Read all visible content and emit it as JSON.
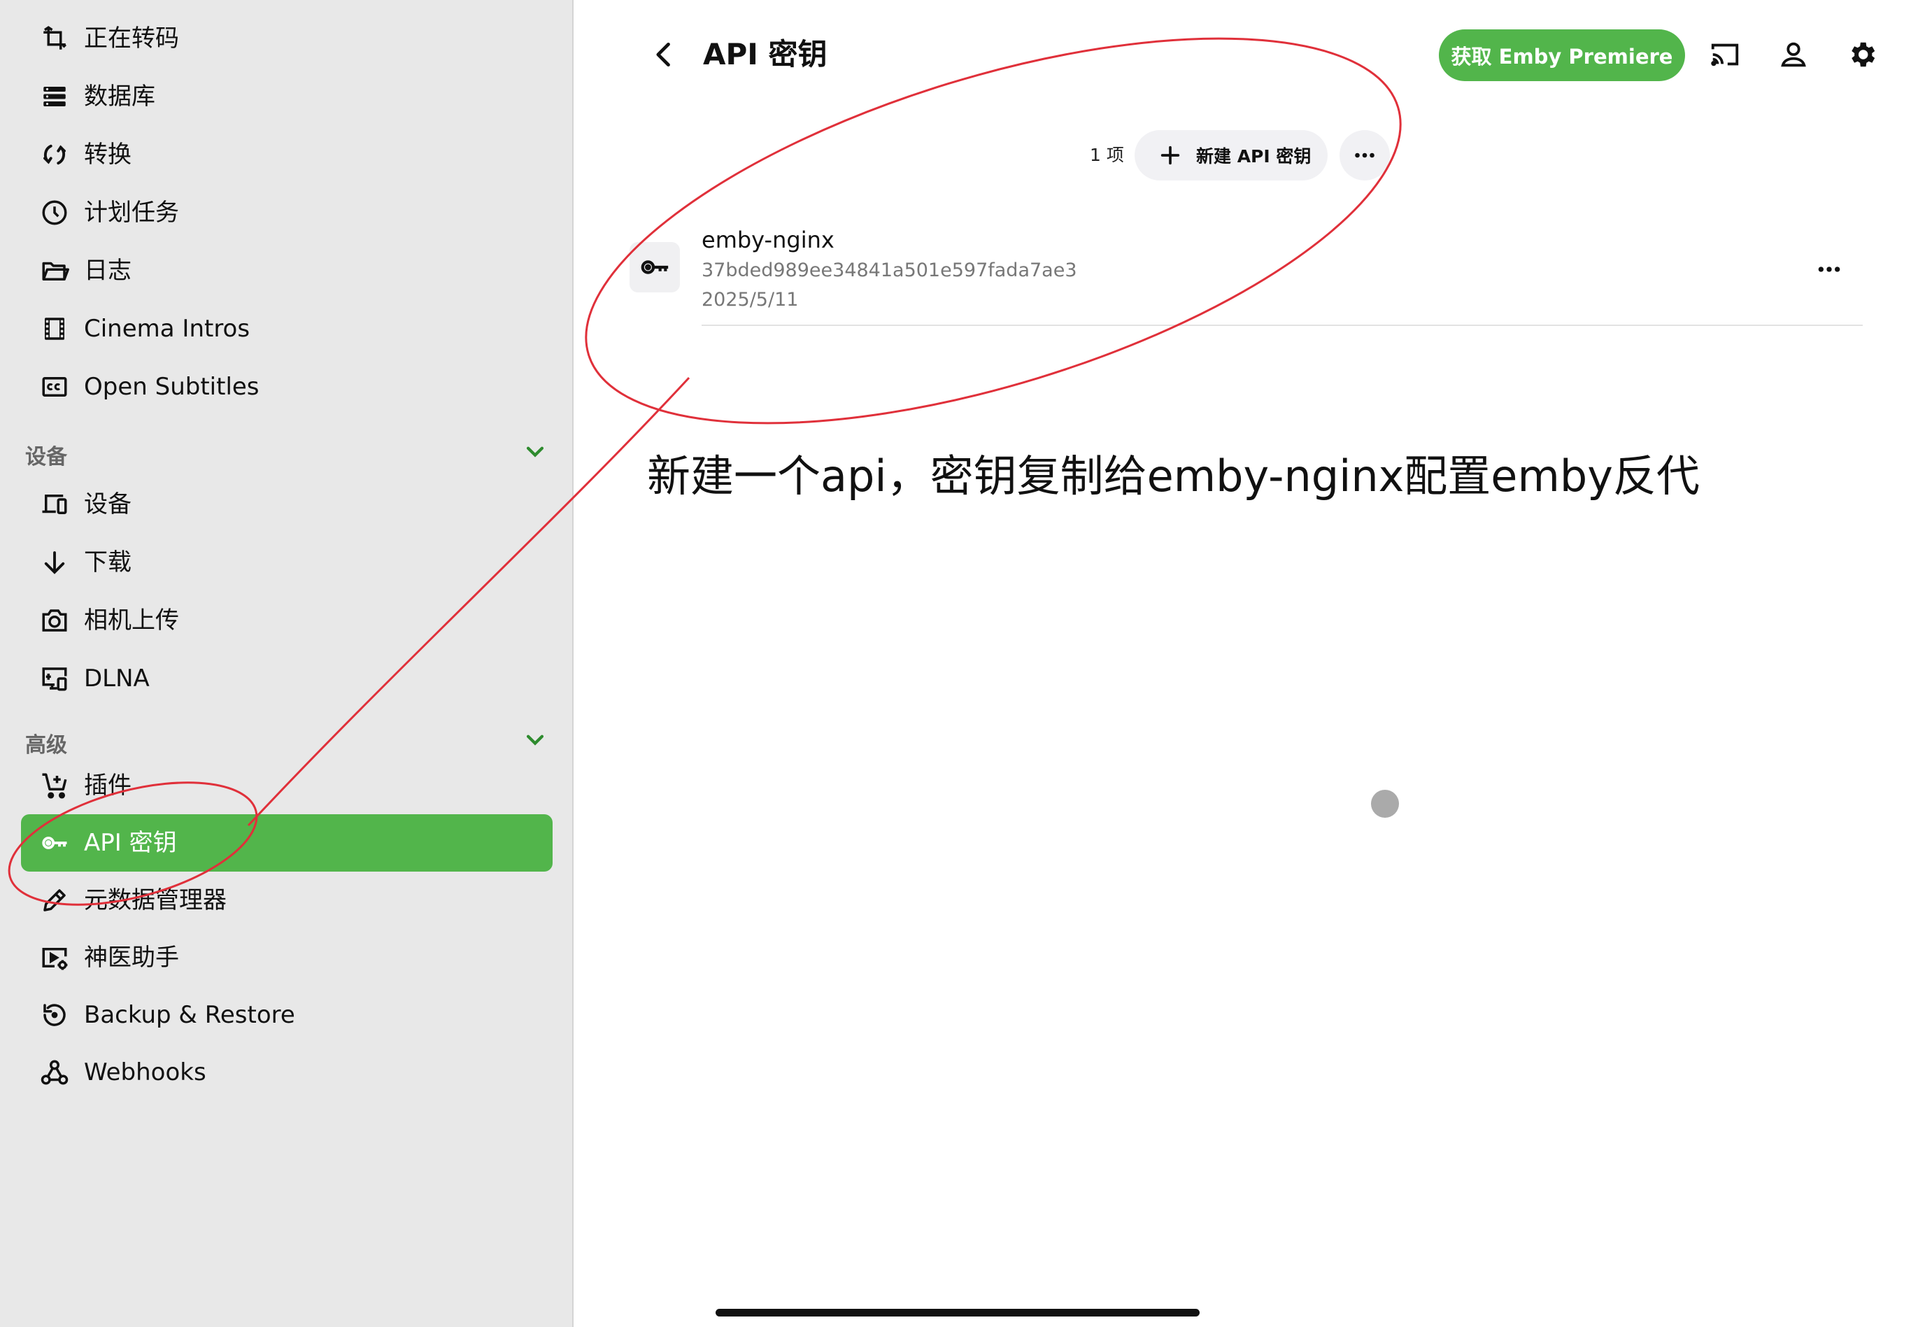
{
  "sidebar": {
    "items_top": [
      {
        "label": "正在转码",
        "icon": "transcode-icon"
      },
      {
        "label": "数据库",
        "icon": "database-icon"
      },
      {
        "label": "转换",
        "icon": "convert-icon"
      },
      {
        "label": "计划任务",
        "icon": "clock-icon"
      },
      {
        "label": "日志",
        "icon": "folder-open-icon"
      },
      {
        "label": "Cinema Intros",
        "icon": "film-icon"
      },
      {
        "label": "Open Subtitles",
        "icon": "closed-caption-icon"
      }
    ],
    "devices_section": {
      "header": "设备",
      "items": [
        {
          "label": "设备",
          "icon": "devices-icon"
        },
        {
          "label": "下载",
          "icon": "arrow-down-icon"
        },
        {
          "label": "相机上传",
          "icon": "camera-icon"
        },
        {
          "label": "DLNA",
          "icon": "dlna-icon"
        }
      ]
    },
    "advanced_section": {
      "header": "高级",
      "items": [
        {
          "label": "插件",
          "icon": "cart-plus-icon"
        },
        {
          "label": "API 密钥",
          "icon": "key-icon",
          "active": true
        },
        {
          "label": "元数据管理器",
          "icon": "pencil-icon"
        },
        {
          "label": "神医助手",
          "icon": "video-settings-icon"
        },
        {
          "label": "Backup & Restore",
          "icon": "restore-icon"
        },
        {
          "label": "Webhooks",
          "icon": "webhooks-icon"
        }
      ]
    }
  },
  "header": {
    "title": "API 密钥",
    "premiere_button": "获取 Emby Premiere"
  },
  "toolbar": {
    "count": "1 项",
    "new_key_button": "新建 API 密钥"
  },
  "api_keys": [
    {
      "name": "emby-nginx",
      "token": "37bded989ee34841a501e597fada7ae3",
      "date": "2025/5/11"
    }
  ],
  "annotation": {
    "text": "新建一个api，密钥复制给emby-nginx配置emby反代"
  },
  "colors": {
    "accent": "#52b54b",
    "sidebar_bg": "#e8e8e8",
    "annotation": "#e0303a"
  }
}
